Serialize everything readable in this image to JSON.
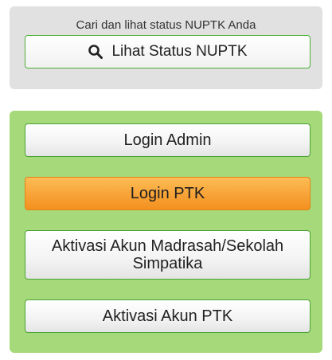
{
  "status_panel": {
    "caption": "Cari dan lihat status NUPTK Anda",
    "button": {
      "label": "Lihat Status NUPTK",
      "icon": "search-icon"
    }
  },
  "login_panel": {
    "buttons": [
      {
        "label": "Login Admin",
        "style": "light"
      },
      {
        "label": "Login PTK",
        "style": "orange"
      },
      {
        "label": "Aktivasi Akun Madrasah/Sekolah Simpatika",
        "style": "light"
      },
      {
        "label": "Aktivasi Akun PTK",
        "style": "light"
      }
    ]
  },
  "colors": {
    "status_panel_bg": "#e1e1e1",
    "login_panel_bg": "#a6d97a",
    "button_border_green": "#49a335",
    "primary_orange": "#f7a034"
  }
}
